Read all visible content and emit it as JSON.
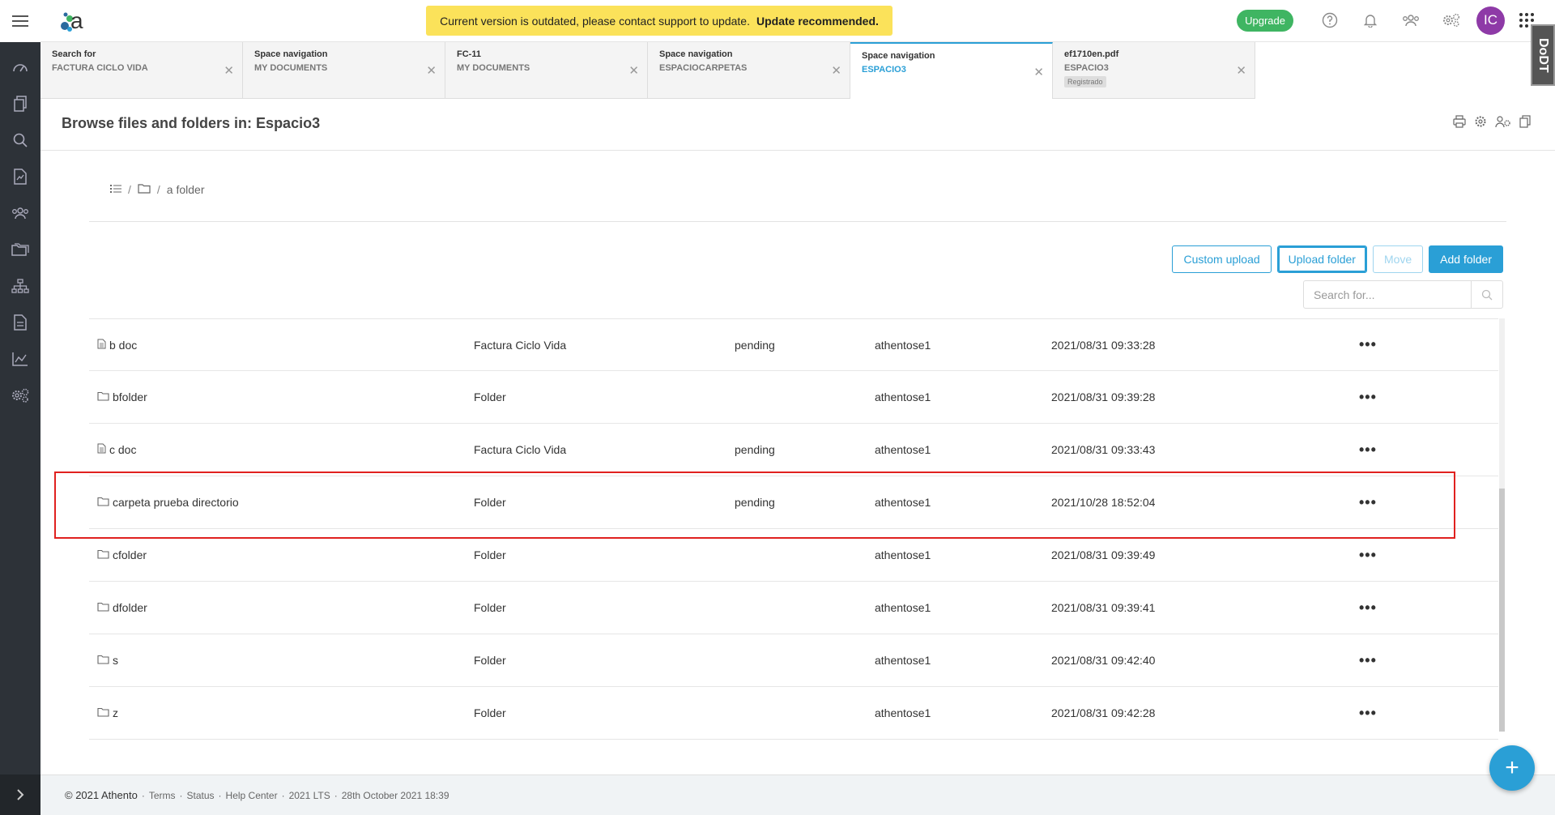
{
  "banner": {
    "message": "Current version is outdated, please contact support to update.",
    "emphasis": "Update recommended."
  },
  "topbar": {
    "upgrade_label": "Upgrade",
    "avatar_initials": "IC"
  },
  "tabs": [
    {
      "title": "Search for",
      "subtitle": "FACTURA CICLO VIDA"
    },
    {
      "title": "Space navigation",
      "subtitle": "MY DOCUMENTS"
    },
    {
      "title": "FC-11",
      "subtitle": "MY DOCUMENTS"
    },
    {
      "title": "Space navigation",
      "subtitle": "ESPACIOCARPETAS"
    },
    {
      "title": "Space navigation",
      "subtitle": "ESPACIO3",
      "active": true
    },
    {
      "title": "ef1710en.pdf",
      "subtitle": "ESPACIO3",
      "tag": "Registrado"
    }
  ],
  "ddt_badge": "DoDT",
  "page": {
    "title": "Browse files and folders in: Espacio3"
  },
  "breadcrumb": {
    "current": "a folder"
  },
  "actions": {
    "custom_upload": "Custom upload",
    "upload_folder": "Upload folder",
    "move": "Move",
    "add_folder": "Add folder"
  },
  "search": {
    "placeholder": "Search for..."
  },
  "rows": [
    {
      "icon": "document-icon",
      "name": "b doc",
      "type": "Factura Ciclo Vida",
      "status": "pending",
      "owner": "athentose1",
      "date": "2021/08/31 09:33:28"
    },
    {
      "icon": "folder-icon",
      "name": "bfolder",
      "type": "Folder",
      "status": "",
      "owner": "athentose1",
      "date": "2021/08/31 09:39:28"
    },
    {
      "icon": "document-icon",
      "name": "c doc",
      "type": "Factura Ciclo Vida",
      "status": "pending",
      "owner": "athentose1",
      "date": "2021/08/31 09:33:43"
    },
    {
      "icon": "folder-icon",
      "name": "carpeta prueba directorio",
      "type": "Folder",
      "status": "pending",
      "owner": "athentose1",
      "date": "2021/10/28 18:52:04",
      "highlighted": true
    },
    {
      "icon": "folder-icon",
      "name": "cfolder",
      "type": "Folder",
      "status": "",
      "owner": "athentose1",
      "date": "2021/08/31 09:39:49"
    },
    {
      "icon": "folder-icon",
      "name": "dfolder",
      "type": "Folder",
      "status": "",
      "owner": "athentose1",
      "date": "2021/08/31 09:39:41"
    },
    {
      "icon": "folder-icon",
      "name": "s",
      "type": "Folder",
      "status": "",
      "owner": "athentose1",
      "date": "2021/08/31 09:42:40"
    },
    {
      "icon": "folder-icon",
      "name": "z",
      "type": "Folder",
      "status": "",
      "owner": "athentose1",
      "date": "2021/08/31 09:42:28"
    }
  ],
  "more_label": "•••",
  "footer": {
    "copyright": "© 2021 Athento",
    "links": [
      "Terms",
      "Status",
      "Help Center",
      "2021 LTS",
      "28th October 2021 18:39"
    ]
  },
  "fab_label": "+",
  "colors": {
    "accent": "#2a9fd6",
    "sidebar": "#2d3238",
    "banner": "#fbe25a",
    "upgrade": "#3fb562",
    "avatar": "#8e3aa7",
    "highlight": "#e0211f"
  }
}
